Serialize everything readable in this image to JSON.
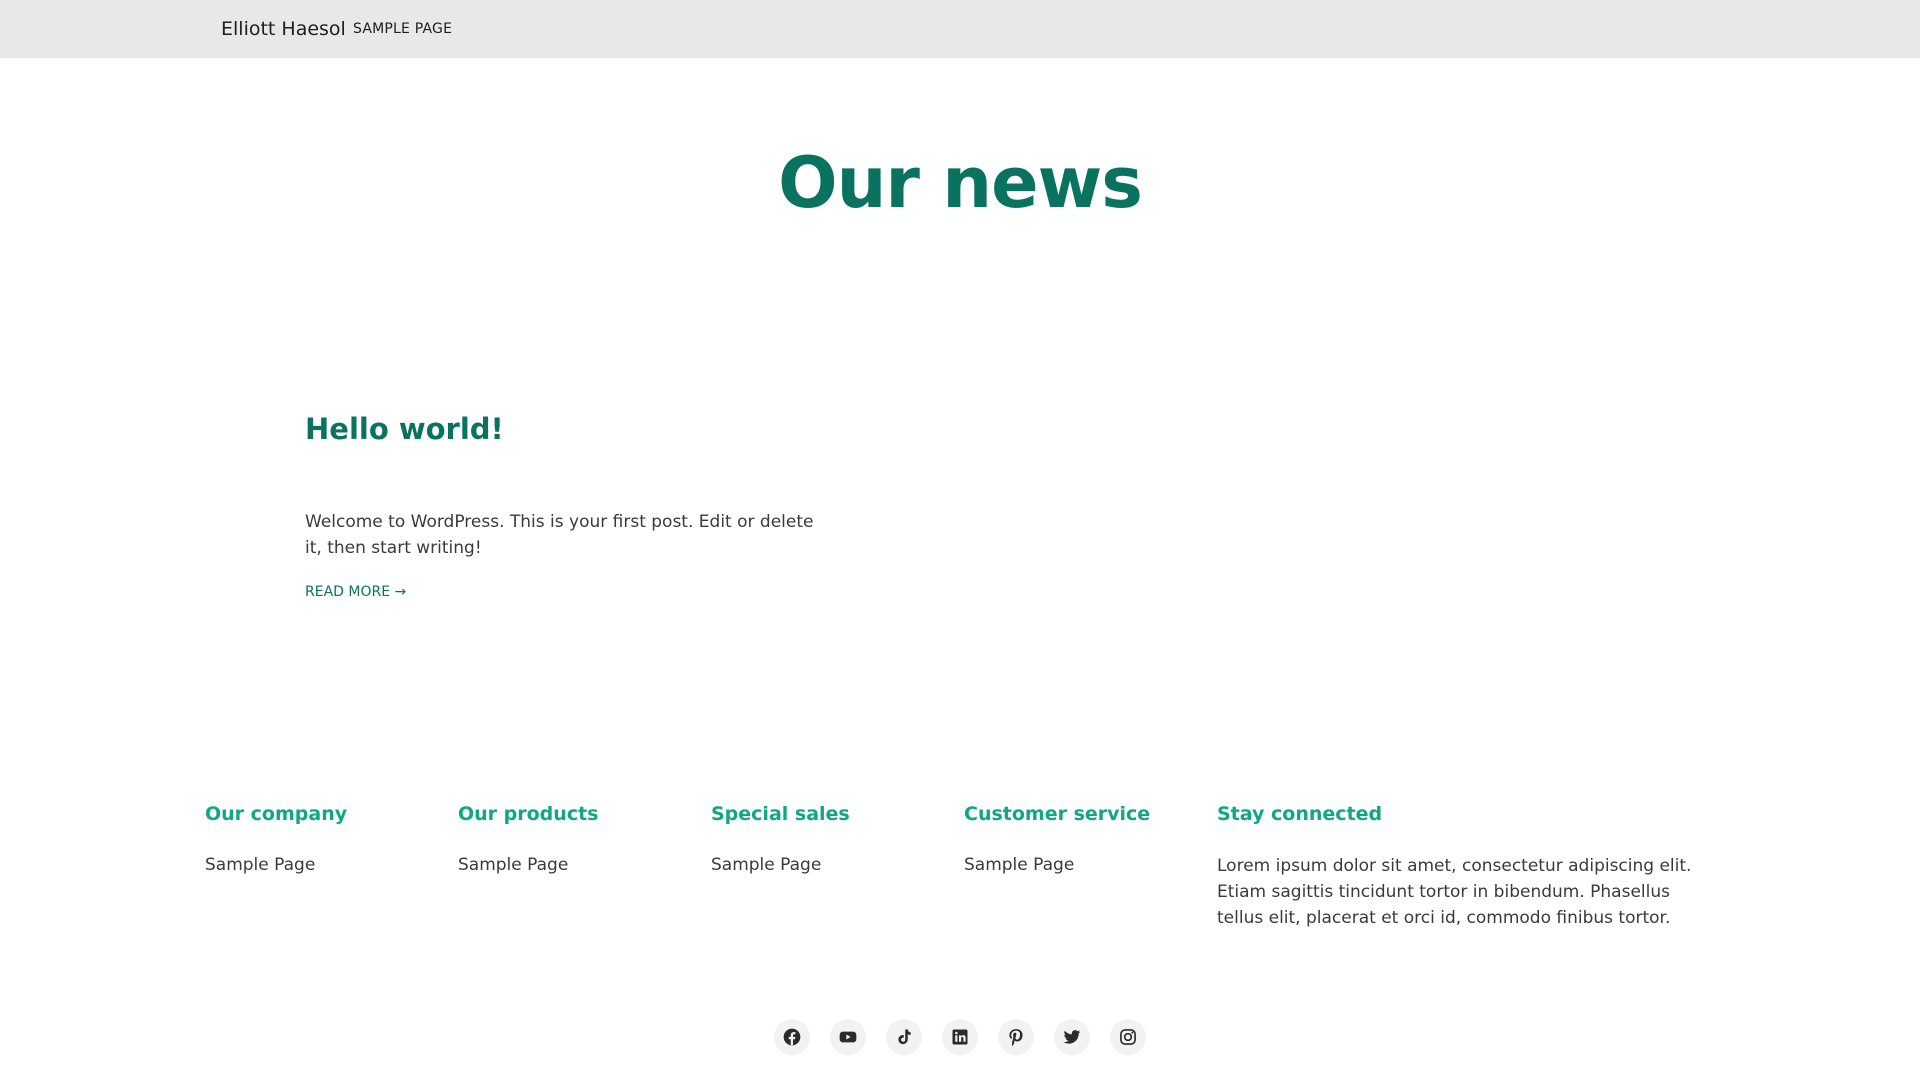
{
  "header": {
    "site_title": "Elliott Haesol",
    "nav": [
      {
        "label": "SAMPLE PAGE"
      }
    ]
  },
  "main": {
    "title": "Our news",
    "posts": [
      {
        "title": "Hello world!",
        "excerpt": "Welcome to WordPress. This is your first post. Edit or delete it, then start writing!",
        "read_more": "READ MORE →"
      }
    ]
  },
  "footer": {
    "columns": [
      {
        "heading": "Our company",
        "link": "Sample Page"
      },
      {
        "heading": "Our products",
        "link": "Sample Page"
      },
      {
        "heading": "Special sales",
        "link": "Sample Page"
      },
      {
        "heading": "Customer service",
        "link": "Sample Page"
      },
      {
        "heading": "Stay connected",
        "text": "Lorem ipsum dolor sit amet, consectetur adipiscing elit. Etiam sagittis tincidunt tortor in bibendum. Phasellus tellus elit, placerat et orci id, commodo finibus tortor."
      }
    ],
    "social": [
      "facebook-icon",
      "youtube-icon",
      "tiktok-icon",
      "linkedin-icon",
      "pinterest-icon",
      "twitter-icon",
      "instagram-icon"
    ]
  },
  "colors": {
    "header_bg": "#e8e8e8",
    "title_green": "#09735f",
    "footer_heading_green": "#0fa884",
    "body_text": "#3a3a3a"
  }
}
